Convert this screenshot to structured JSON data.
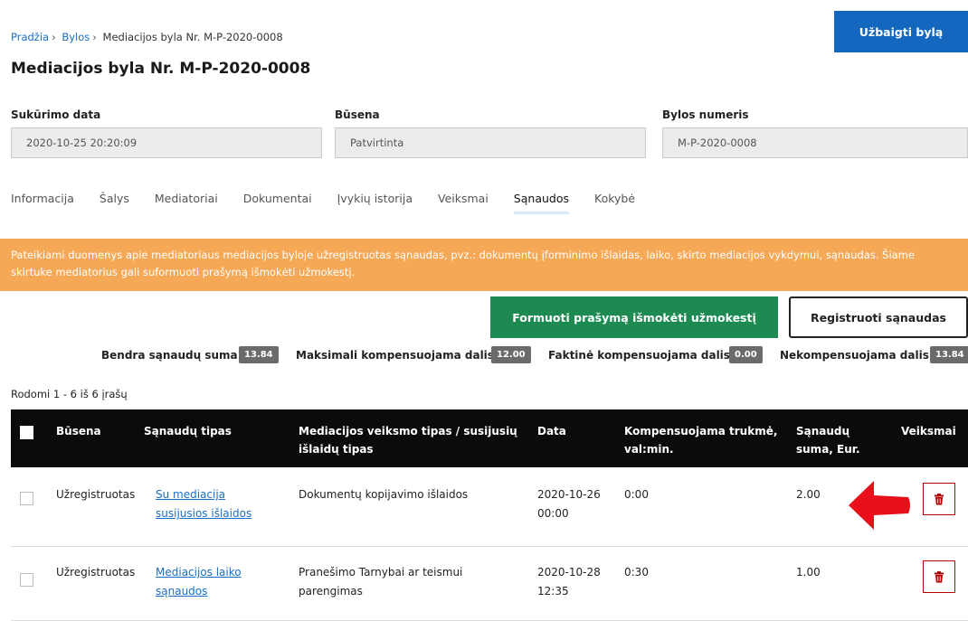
{
  "breadcrumb": {
    "home": "Pradžia",
    "files": "Bylos",
    "current": "Mediacijos byla Nr. M-P-2020-0008",
    "separator": "›"
  },
  "header": {
    "finish_button": "Užbaigti bylą",
    "title": "Mediacijos byla Nr. M-P-2020-0008"
  },
  "fields": {
    "created_label": "Sukūrimo data",
    "created_value": "2020-10-25 20:20:09",
    "status_label": "Būsena",
    "status_value": "Patvirtinta",
    "number_label": "Bylos numeris",
    "number_value": "M-P-2020-0008"
  },
  "tabs": [
    "Informacija",
    "Šalys",
    "Mediatoriai",
    "Dokumentai",
    "Įvykių istorija",
    "Veiksmai",
    "Sąnaudos",
    "Kokybė"
  ],
  "active_tab": "Sąnaudos",
  "banner": {
    "text": "Pateikiami duomenys apie mediatoriaus mediacijos byloje užregistruotas sąnaudas, pvz.: dokumentų įforminimo išlaidas, laiko, skirto mediacijos vykdymui, sąnaudas. Šiame skirtuke mediatorius gali suformuoti prašymą išmokėti užmokestį."
  },
  "actions": {
    "form_request": "Formuoti prašymą išmokėti užmokestį",
    "register_costs": "Registruoti sąnaudas"
  },
  "summary": {
    "total_label": "Bendra sąnaudų suma",
    "total_value": "13.84",
    "max_label": "Maksimali kompensuojama dalis",
    "max_value": "12.00",
    "actual_label": "Faktinė kompensuojama dalis",
    "actual_value": "0.00",
    "noncomp_label": "Nekompensuojama dalis",
    "noncomp_value": "13.84"
  },
  "records_info": "Rodomi 1 - 6 iš 6 įrašų",
  "table": {
    "headers": {
      "status": "Būsena",
      "cost_type": "Sąnaudų tipas",
      "action_type_1": "Mediacijos veiksmo tipas / susijusių",
      "action_type_2": "išlaidų tipas",
      "date": "Data",
      "duration_1": "Kompensuojama trukmė,",
      "duration_2": "val:min.",
      "amount_1": "Sąnaudų",
      "amount_2": "suma, Eur.",
      "actions": "Veiksmai"
    },
    "rows": [
      {
        "status": "Užregistruotas",
        "cost_type_1": "Su mediacija",
        "cost_type_2": "susijusios išlaidos",
        "action_type_1": "Dokumentų kopijavimo išlaidos",
        "action_type_2": "",
        "date_1": "2020-10-26",
        "date_2": "00:00",
        "duration": "0:00",
        "amount": "2.00"
      },
      {
        "status": "Užregistruotas",
        "cost_type_1": "Mediacijos laiko",
        "cost_type_2": "sąnaudos",
        "action_type_1": "Pranešimo Tarnybai ar teismui",
        "action_type_2": "parengimas",
        "date_1": "2020-10-28",
        "date_2": "12:35",
        "duration": "0:30",
        "amount": "1.00"
      }
    ]
  },
  "colors": {
    "primary_blue": "#1467bf",
    "green": "#1d8a52",
    "banner_orange": "#f5a855",
    "delete_red": "#b30000",
    "arrow_red": "#e8101a"
  }
}
